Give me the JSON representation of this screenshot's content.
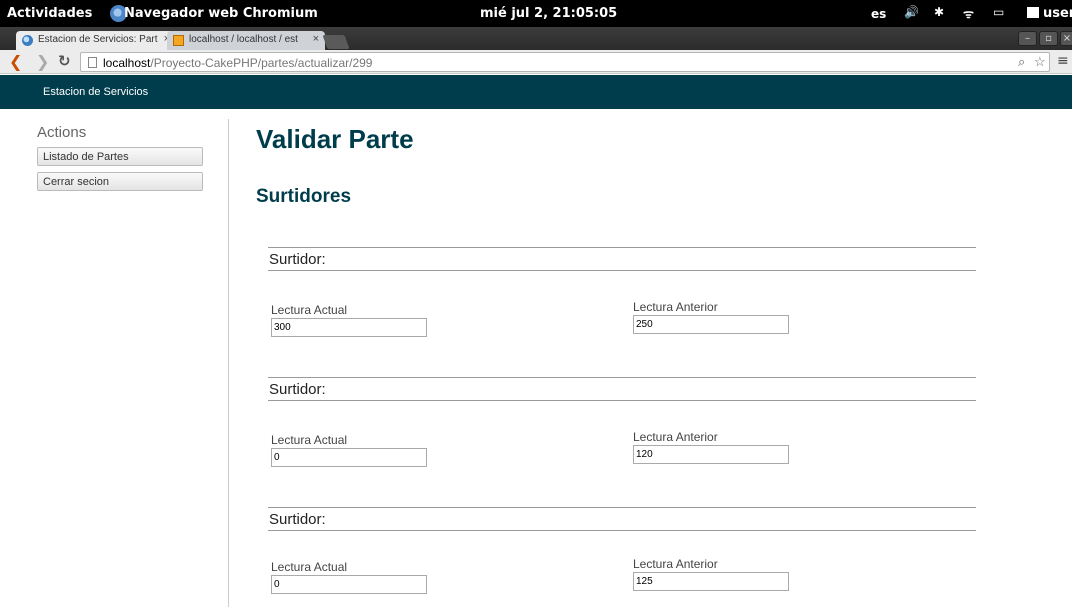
{
  "topbar": {
    "activities": "Actividades",
    "app_name": "Navegador web Chromium",
    "clock": "mié jul  2, 21:05:05",
    "lang": "es",
    "user": "user"
  },
  "browser": {
    "tabs": [
      {
        "label": "Estacion de Servicios: Part",
        "active": true
      },
      {
        "label": "localhost / localhost / est",
        "active": false
      }
    ],
    "url_host": "localhost",
    "url_path": "/Proyecto-CakePHP/partes/actualizar/299"
  },
  "page": {
    "header": "Estacion de Servicios",
    "sidebar": {
      "title": "Actions",
      "buttons": [
        "Listado de Partes",
        "Cerrar secion"
      ]
    },
    "title": "Validar Parte",
    "section": "Surtidores",
    "surtidores": [
      {
        "legend": "Surtidor:",
        "actual_label": "Lectura Actual",
        "actual_value": "300",
        "anterior_label": "Lectura Anterior",
        "anterior_value": "250"
      },
      {
        "legend": "Surtidor:",
        "actual_label": "Lectura Actual",
        "actual_value": "0",
        "anterior_label": "Lectura Anterior",
        "anterior_value": "120"
      },
      {
        "legend": "Surtidor:",
        "actual_label": "Lectura Actual",
        "actual_value": "0",
        "anterior_label": "Lectura Anterior",
        "anterior_value": "125"
      }
    ]
  }
}
